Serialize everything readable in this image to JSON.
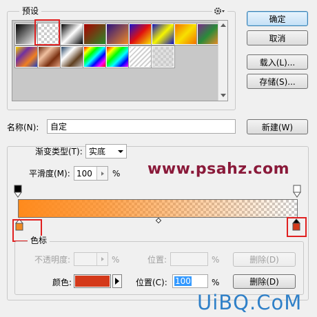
{
  "presets": {
    "legend": "预设",
    "gear_icon": "gear-icon",
    "swatches": [
      {
        "name": "black-to-white",
        "bg": "linear-gradient(135deg,#000,#fff)"
      },
      {
        "name": "foreground-to-transparent",
        "bg": "checker"
      },
      {
        "name": "black-white",
        "bg": "linear-gradient(135deg,#000 0%,#fff 50%,#000 100%)"
      },
      {
        "name": "red-green",
        "bg": "linear-gradient(135deg,#a00,#2a8a2a)"
      },
      {
        "name": "violet-orange",
        "bg": "linear-gradient(135deg,#291380,#f08a24)"
      },
      {
        "name": "blue-red-yellow",
        "bg": "linear-gradient(135deg,#1414d0,#e01010,#f5e500)"
      },
      {
        "name": "blue-yellow-blue",
        "bg": "linear-gradient(135deg,#1010c0,#f5f500,#1010c0)"
      },
      {
        "name": "orange-yellow-orange",
        "bg": "linear-gradient(135deg,#f07000,#f8e000,#f07000)"
      },
      {
        "name": "violet-green-orange",
        "bg": "linear-gradient(135deg,#7a2a8a,#2a8a3a,#f08a24)"
      },
      {
        "name": "yellow-violet-orange-blue",
        "bg": "linear-gradient(135deg,#f5d000,#7030a0,#f08020,#2040c0)"
      },
      {
        "name": "copper",
        "bg": "linear-gradient(135deg,#6a2a10,#f0c0a0,#7a3010,#e0a080)"
      },
      {
        "name": "chrome",
        "bg": "linear-gradient(135deg,#204060,#fff,#604020,#c0c0c0)"
      },
      {
        "name": "spectrum",
        "bg": "linear-gradient(135deg,#f00,#ff0,#0f0,#0ff,#00f,#f0f,#f00)"
      },
      {
        "name": "transparent-rainbow",
        "bg": "linear-gradient(135deg,#f00,#ff0,#0f0,#0ff,#00f,#f0f)"
      },
      {
        "name": "transparent-stripes",
        "bg": "repeating-linear-gradient(135deg,#d0d0d0 0,#d0d0d0 2px,#fff 2px,#fff 5px)"
      },
      {
        "name": "neutral-density",
        "bg": "checker-dark"
      }
    ]
  },
  "buttons": {
    "ok": "确定",
    "cancel": "取消",
    "load": "载入(L)...",
    "save": "存储(S)...",
    "new": "新建(W)",
    "delete_opacity": "删除(D)",
    "delete_color": "删除(D)"
  },
  "name": {
    "label": "名称(N):",
    "value": "自定"
  },
  "gradient_type": {
    "label": "渐变类型(T):",
    "value": "实底"
  },
  "smoothness": {
    "label": "平滑度(M):",
    "value": "100",
    "unit": "%"
  },
  "stops": {
    "legend": "色标",
    "opacity_label": "不透明度:",
    "opacity_unit": "%",
    "opacity_location_label": "位置:",
    "opacity_location_unit": "%",
    "color_label": "颜色:",
    "color_value": "#d4391a",
    "color_location_label": "位置(C):",
    "color_location_value": "100",
    "color_location_unit": "%"
  },
  "gradient_bar": {
    "from_color": "#ff8a1c",
    "to_color": "#f25a1a",
    "start_stop_color": "#f08a24",
    "end_stop_color": "#d4391a"
  },
  "watermark": "www.psahz.com",
  "logo": "UiBQ.CoM"
}
